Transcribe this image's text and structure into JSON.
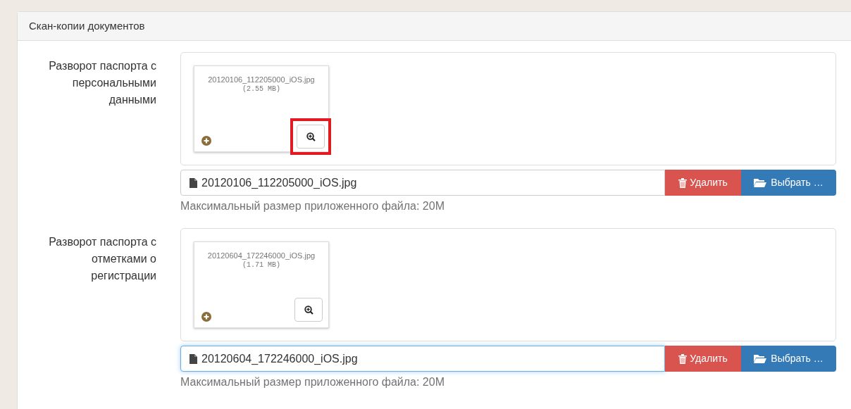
{
  "panel": {
    "title": "Скан-копии документов"
  },
  "uploads": [
    {
      "label": "Разворот паспорта с персональными данными",
      "thumb_name": "20120106_112205000_iOS.jpg",
      "thumb_size": "(2.55 MB)",
      "zoom_highlighted": true,
      "file_name": "20120106_112205000_iOS.jpg",
      "focused": false,
      "remove_button": "Удалить",
      "browse_button": "Выбрать …",
      "hint": "Максимальный размер приложенного файла: 20M"
    },
    {
      "label": "Разворот паспорта с отметками о регистрации",
      "thumb_name": "20120604_172246000_iOS.jpg",
      "thumb_size": "(1.71 MB)",
      "zoom_highlighted": false,
      "file_name": "20120604_172246000_iOS.jpg",
      "focused": true,
      "remove_button": "Удалить",
      "browse_button": "Выбрать …",
      "hint": "Максимальный размер приложенного файла: 20M"
    }
  ]
}
